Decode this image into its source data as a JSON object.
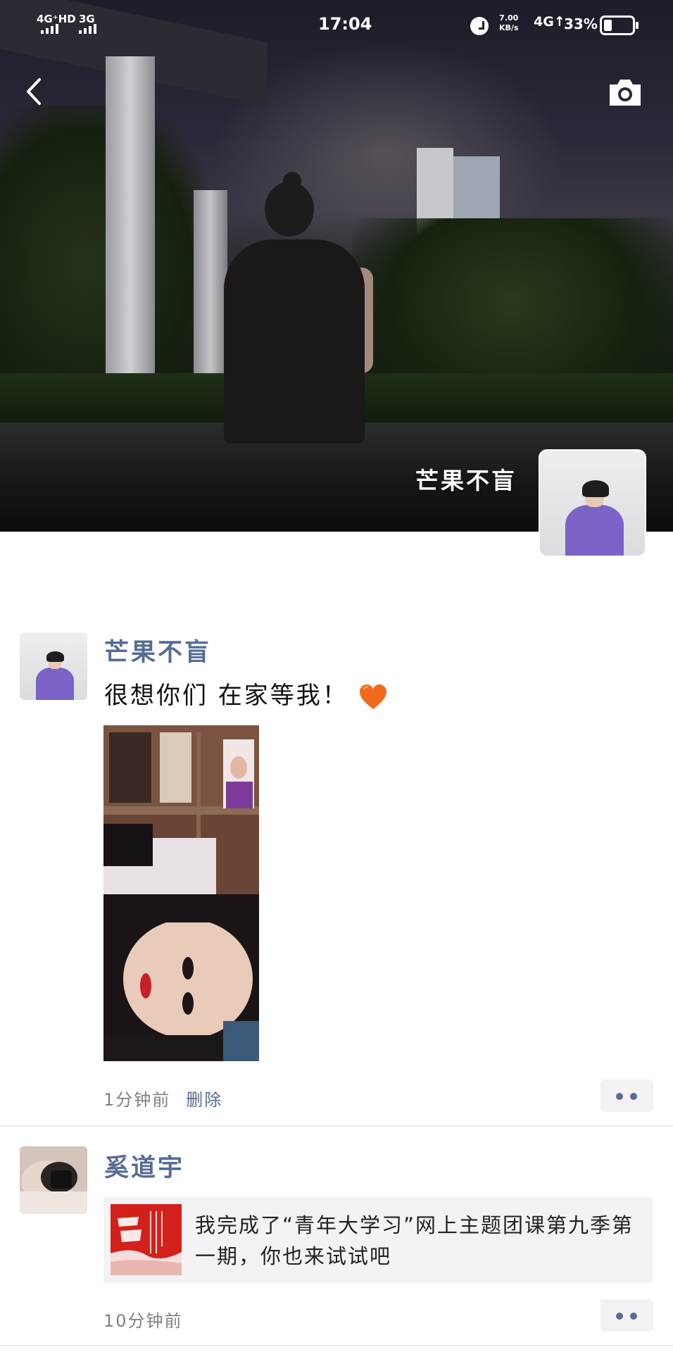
{
  "status_bar": {
    "network1": "4G⁺HD",
    "network2": "3G",
    "time": "17:04",
    "speed_value": "7.00",
    "speed_unit": "KB/s",
    "network3": "4G↑",
    "battery": "33%"
  },
  "cover": {
    "name": "芒果不盲"
  },
  "posts": [
    {
      "username": "芒果不盲",
      "text": "很想你们 在家等我！",
      "time": "1分钟前",
      "delete_label": "删除"
    },
    {
      "username": "奚道宇",
      "share_text": "我完成了“青年大学习”网上主题团课第九季第一期，你也来试试吧",
      "time": "10分钟前"
    }
  ],
  "colors": {
    "link": "#576b95",
    "meta": "#808080",
    "text": "#111111"
  }
}
